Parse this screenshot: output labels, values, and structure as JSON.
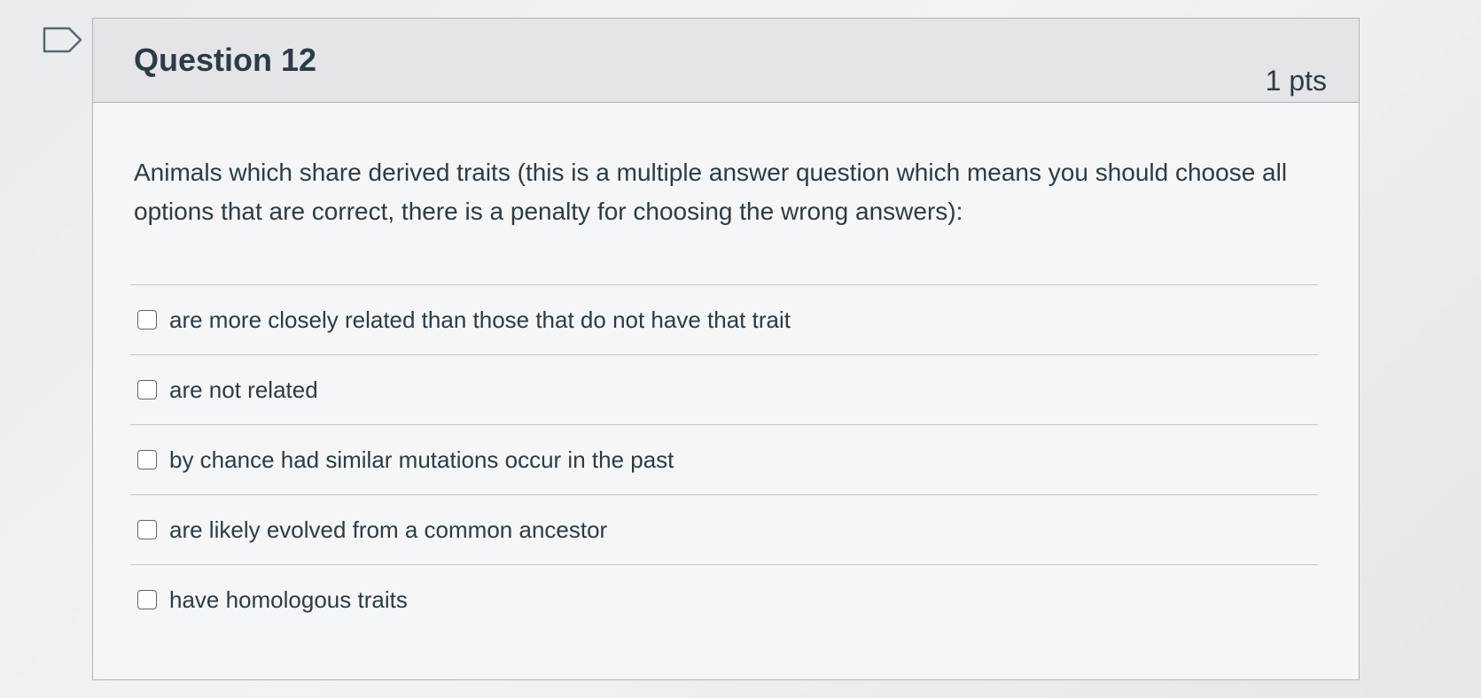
{
  "question": {
    "title": "Question 12",
    "points": "1 pts",
    "prompt": "Animals which share derived traits (this is a multiple answer question which means you should choose all options that are correct, there is a penalty for choosing the wrong answers):"
  },
  "answers": [
    {
      "label": "are more closely related than those that do not have that trait",
      "checked": false
    },
    {
      "label": "are not related",
      "checked": false
    },
    {
      "label": "by chance had similar mutations occur in the past",
      "checked": false
    },
    {
      "label": "are likely evolved from a common ancestor",
      "checked": false
    },
    {
      "label": "have homologous traits",
      "checked": false
    }
  ],
  "icons": {
    "flag": "flag-question-icon"
  },
  "colors": {
    "text": "#2d3b45",
    "header_bg": "#e3e5e8",
    "border": "#b0b4b8",
    "checkbox_border": "#5b6670"
  }
}
